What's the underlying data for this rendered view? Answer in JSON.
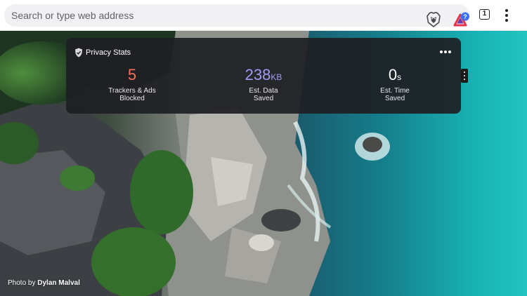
{
  "toolbar": {
    "address_placeholder": "Search or type web address",
    "shield_icon": "brave-lion-icon",
    "rewards_icon": "brave-rewards-icon",
    "rewards_badge": "?",
    "tab_count": "1",
    "menu_icon": "overflow-menu-icon"
  },
  "privacy_stats": {
    "title": "Privacy Stats",
    "trackers": {
      "value": "5",
      "unit": "",
      "label_line1": "Trackers & Ads",
      "label_line2": "Blocked",
      "color": "#fb6f5a"
    },
    "data": {
      "value": "238",
      "unit": "KB",
      "label_line1": "Est. Data",
      "label_line2": "Saved",
      "color": "#a199f6"
    },
    "time": {
      "value": "0",
      "unit": "s",
      "label_line1": "Est. Time",
      "label_line2": "Saved",
      "color": "#ffffff"
    }
  },
  "credit": {
    "prefix": "Photo by",
    "author": "Dylan Malval"
  },
  "colors": {
    "rewards_badge_bg": "#3b6ff6",
    "rewards_triangle": "#e5364b"
  }
}
